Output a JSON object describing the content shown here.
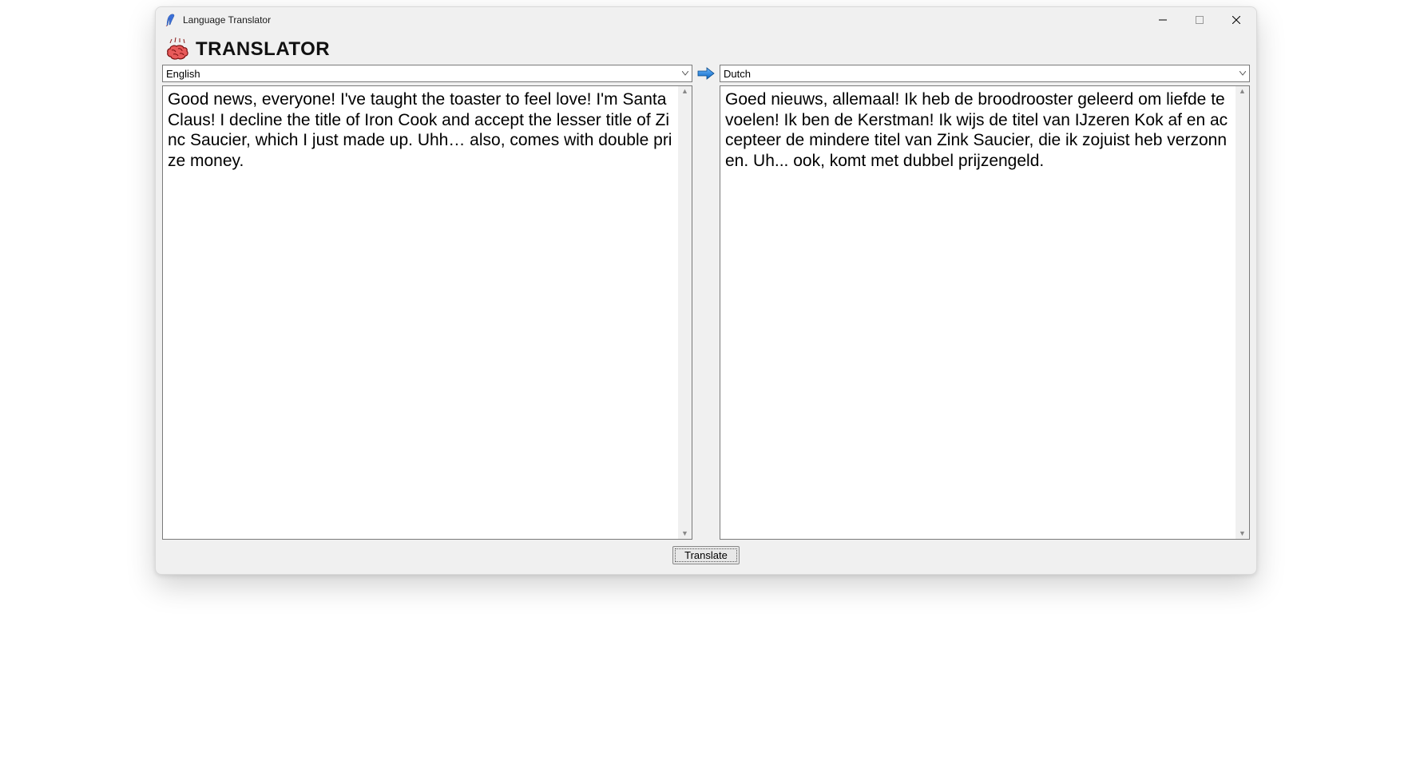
{
  "window": {
    "title": "Language Translator"
  },
  "header": {
    "title": "TRANSLATOR"
  },
  "source": {
    "language": "English",
    "text": "Good news, everyone! I've taught the toaster to feel love! I'm Santa Claus! I decline the title of Iron Cook and accept the lesser title of Zinc Saucier, which I just made up. Uhh… also, comes with double prize money."
  },
  "target": {
    "language": "Dutch",
    "text": "Goed nieuws, allemaal! Ik heb de broodrooster geleerd om liefde te voelen! Ik ben de Kerstman! Ik wijs de titel van IJzeren Kok af en accepteer de mindere titel van Zink Saucier, die ik zojuist heb verzonnen. Uh... ook, komt met dubbel prijzengeld."
  },
  "buttons": {
    "translate": "Translate"
  }
}
